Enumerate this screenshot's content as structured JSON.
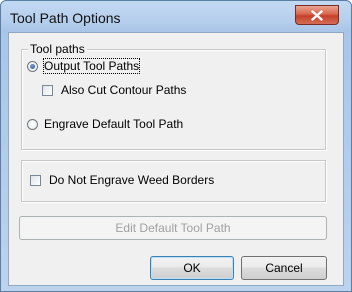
{
  "window": {
    "title": "Tool Path Options"
  },
  "tool_paths_group": {
    "legend": "Tool paths",
    "output_tool_paths": {
      "label": "Output Tool Paths",
      "checked": true
    },
    "also_cut_contour_paths": {
      "label": "Also Cut Contour Paths",
      "checked": false
    },
    "engrave_default_tool_path": {
      "label": "Engrave Default Tool Path",
      "checked": false
    }
  },
  "weed_group": {
    "do_not_engrave_weed_borders": {
      "label": "Do Not Engrave Weed Borders",
      "checked": false
    }
  },
  "buttons": {
    "edit_default_tool_path": "Edit Default Tool Path",
    "ok": "OK",
    "cancel": "Cancel"
  },
  "colors": {
    "close_button": "#c5402a",
    "dialog_background": "#f0f0f0"
  }
}
